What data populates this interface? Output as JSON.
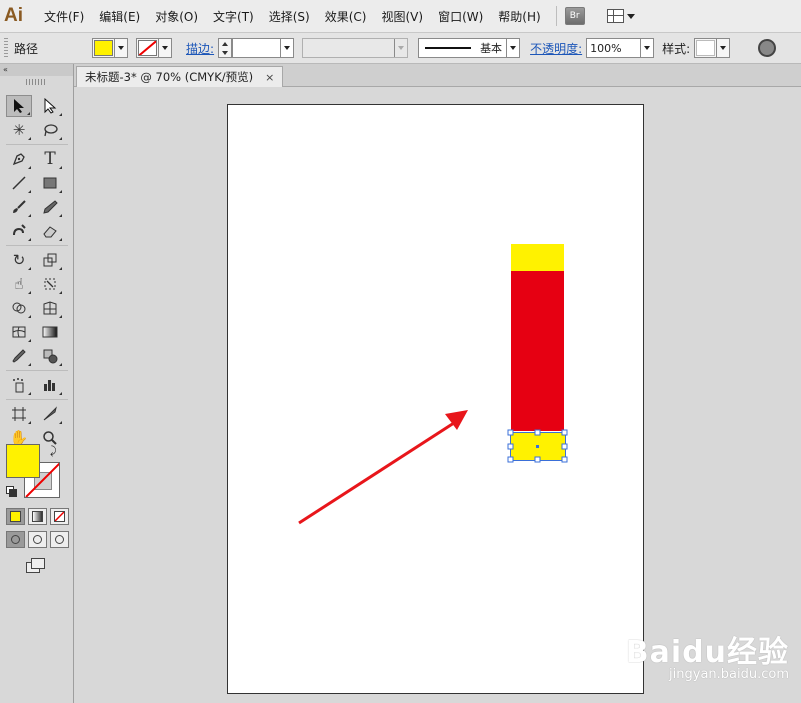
{
  "app": {
    "logo": "Ai"
  },
  "menu": {
    "items": [
      "文件(F)",
      "编辑(E)",
      "对象(O)",
      "文字(T)",
      "选择(S)",
      "效果(C)",
      "视图(V)",
      "窗口(W)",
      "帮助(H)"
    ],
    "bridge_label": "Br"
  },
  "control_bar": {
    "selection_type": "路径",
    "fill_color": "#fff200",
    "stroke_label": "描边:",
    "stroke_profile": "基本",
    "opacity_label": "不透明度:",
    "opacity_value": "100%",
    "style_label": "样式:"
  },
  "toolbox": {
    "collapse_label": "«",
    "tool_icons": [
      [
        "selection-tool-icon",
        "direct-selection-tool-icon"
      ],
      [
        "magic-wand-tool-icon",
        "lasso-tool-icon"
      ],
      [
        "pen-tool-icon",
        "type-tool-icon"
      ],
      [
        "line-segment-tool-icon",
        "rectangle-tool-icon"
      ],
      [
        "paintbrush-tool-icon",
        "pencil-tool-icon"
      ],
      [
        "blob-brush-tool-icon",
        "eraser-tool-icon"
      ],
      [
        "rotate-tool-icon",
        "scale-tool-icon"
      ],
      [
        "warp-tool-icon",
        "free-transform-tool-icon"
      ],
      [
        "shape-builder-tool-icon",
        "perspective-grid-tool-icon"
      ],
      [
        "mesh-tool-icon",
        "gradient-tool-icon"
      ],
      [
        "eyedropper-tool-icon",
        "blend-tool-icon"
      ],
      [
        "symbol-sprayer-tool-icon",
        "column-graph-tool-icon"
      ],
      [
        "artboard-tool-icon",
        "slice-tool-icon"
      ],
      [
        "hand-tool-icon",
        "zoom-tool-icon"
      ]
    ],
    "fill_color": "#fff200"
  },
  "document": {
    "tab_title": "未标题-3* @ 70% (CMYK/预览)",
    "close_glyph": "×"
  },
  "artwork": {
    "yellow": "#fff200",
    "red": "#e60012",
    "selection_color": "#3a6fd8",
    "arrow_color": "#e8161b"
  },
  "watermark": {
    "brand": "Baidu经验",
    "url": "jingyan.baidu.com"
  }
}
